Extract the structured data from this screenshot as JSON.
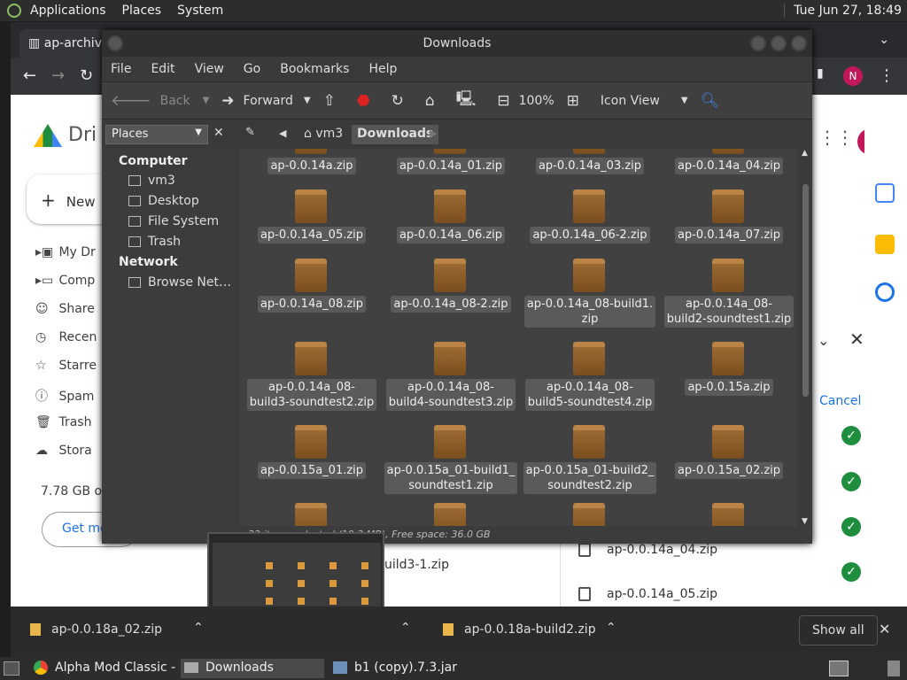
{
  "topbar": {
    "menus": [
      "Applications",
      "Places",
      "System"
    ],
    "clock": "Tue Jun 27, 18:49"
  },
  "chrome": {
    "tab_title": "ap-archive",
    "app_title": "Dri",
    "new_label": "New",
    "nav": [
      "My Dr",
      "Comp",
      "Share",
      "Recen",
      "Starre",
      "Spam",
      "Trash",
      "Stora"
    ],
    "storage": "7.78 GB of",
    "get_more": "Get mo",
    "avatar": "N",
    "upload": {
      "cancel": "Cancel",
      "rows": [
        "ap-0.0.14a_04.zip",
        "ap-0.0.14a_05.zip"
      ],
      "partial": "uild3-1.zip"
    }
  },
  "nautilus": {
    "title": "Downloads",
    "menu": [
      "File",
      "Edit",
      "View",
      "Go",
      "Bookmarks",
      "Help"
    ],
    "toolbar": {
      "back": "Back",
      "forward": "Forward",
      "zoom": "100%",
      "view": "Icon View"
    },
    "places_label": "Places",
    "crumbs": [
      "vm3",
      "Downloads"
    ],
    "sidebar": {
      "computer": "Computer",
      "items": [
        "vm3",
        "Desktop",
        "File System",
        "Trash"
      ],
      "network": "Network",
      "net_items": [
        "Browse Net…"
      ]
    },
    "files": [
      [
        "ap-0.0.14a.zip",
        "ap-0.0.14a_01.zip",
        "ap-0.0.14a_03.zip",
        "ap-0.0.14a_04.zip"
      ],
      [
        "ap-0.0.14a_05.zip",
        "ap-0.0.14a_06.zip",
        "ap-0.0.14a_06-2.zip",
        "ap-0.0.14a_07.zip"
      ],
      [
        "ap-0.0.14a_08.zip",
        "ap-0.0.14a_08-2.zip",
        "ap-0.0.14a_08-build1.\nzip",
        "ap-0.0.14a_08-\nbuild2-soundtest1.zip"
      ],
      [
        "ap-0.0.14a_08-\nbuild3-soundtest2.zip",
        "ap-0.0.14a_08-\nbuild4-soundtest3.zip",
        "ap-0.0.14a_08-\nbuild5-soundtest4.zip",
        "ap-0.0.15a.zip"
      ],
      [
        "ap-0.0.15a_01.zip",
        "ap-0.0.15a_01-build1_\nsoundtest1.zip",
        "ap-0.0.15a_01-build2_\nsoundtest2.zip",
        "ap-0.0.15a_02.zip"
      ]
    ],
    "status": "32 items selected (19.2 MB), Free space: 36.0 GB"
  },
  "shelf": {
    "items": [
      "ap-0.0.18a_02.zip",
      "ap-0.0.18a-build2.zip"
    ],
    "show_all": "Show all"
  },
  "taskbar": {
    "tasks": [
      "Alpha Mod Classic - ...",
      "Downloads",
      "b1 (copy).7.3.jar"
    ]
  }
}
